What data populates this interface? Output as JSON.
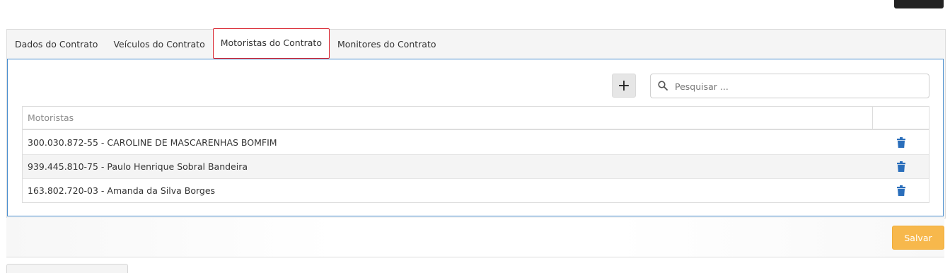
{
  "tabs": [
    {
      "label": "Dados do Contrato"
    },
    {
      "label": "Veículos do Contrato"
    },
    {
      "label": "Motoristas do Contrato"
    },
    {
      "label": "Monitores do Contrato"
    }
  ],
  "active_tab": "Motoristas do Contrato",
  "toolbar": {
    "add_label": "+",
    "search_placeholder": "Pesquisar ..."
  },
  "table": {
    "header": "Motoristas",
    "rows": [
      {
        "text": "300.030.872-55 - CAROLINE DE MASCARENHAS BOMFIM",
        "action_icon": "trash-icon"
      },
      {
        "text": "939.445.810-75 - Paulo Henrique Sobral Bandeira",
        "action_icon": "trash-icon"
      },
      {
        "text": "163.802.720-03 - Amanda da Silva Borges",
        "action_icon": "trash-icon"
      }
    ]
  },
  "footer": {
    "save_label": "Salvar"
  },
  "colors": {
    "active_tab_border": "#d9232e",
    "tab_content_border": "#4a8fcf",
    "trash_icon": "#2a6ebb",
    "save_button": "#f7b84c"
  }
}
